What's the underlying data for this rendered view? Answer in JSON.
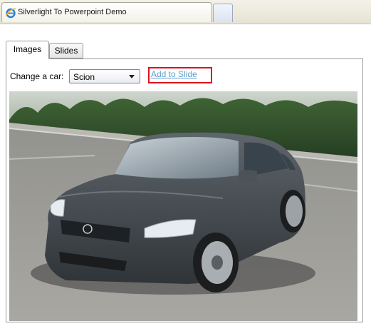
{
  "browser": {
    "tab_title": "Silverlight To Powerpoint Demo",
    "tab_icon": "internet-explorer-icon",
    "new_tab_icon": "new-tab-icon"
  },
  "app": {
    "tabs": [
      {
        "label": "Images",
        "selected": true
      },
      {
        "label": "Slides",
        "selected": false
      }
    ],
    "change_car_label": "Change a car:",
    "car_select": {
      "selected": "Scion",
      "arrow_icon": "dropdown-arrow-icon"
    },
    "add_to_slide_label": "Add to Slide",
    "highlight_color": "#e0101e",
    "link_color": "#5f9fcf",
    "image": {
      "subject": "dark gray Scion tC coupe in a parking lot"
    }
  }
}
